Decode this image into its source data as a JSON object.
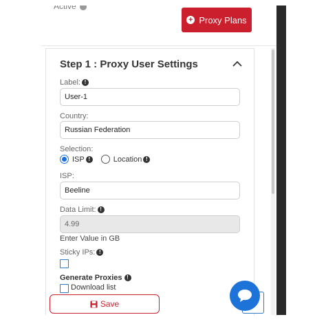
{
  "header": {
    "status_text": "Active",
    "plans_button": "Proxy Plans"
  },
  "card": {
    "title": "Step 1 : Proxy User Settings",
    "label": {
      "caption": "Label:",
      "value": "User-1"
    },
    "country": {
      "caption": "Country:",
      "value": "Russian Federation"
    },
    "selection": {
      "caption": "Selection:",
      "options": [
        "ISP",
        "Location"
      ],
      "selected": "ISP"
    },
    "isp": {
      "caption": "ISP:",
      "value": "Beeline"
    },
    "data_limit": {
      "caption": "Data Limit:",
      "value": "4.99",
      "hint": "Enter Value in GB"
    },
    "sticky_ips": {
      "caption": "Sticky IPs:",
      "checked": false
    },
    "generate": {
      "caption": "Generate Proxies",
      "download_label": "Download list",
      "checked": false
    },
    "save_button": "Save"
  },
  "colors": {
    "brand_red": "#cc1f2d",
    "accent_blue": "#1e73d8"
  }
}
